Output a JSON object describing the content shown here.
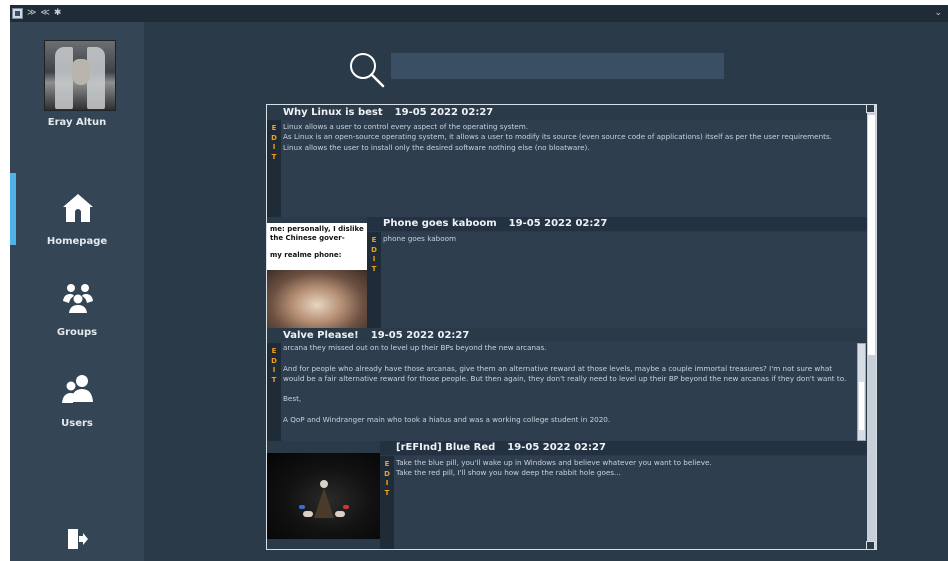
{
  "titlebar": {
    "left_glyphs": [
      "≫",
      "≪",
      "✱"
    ],
    "right_glyph": "⌄"
  },
  "sidebar": {
    "user_name": "Eray Altun",
    "nav": [
      {
        "label": "Homepage",
        "icon": "home-icon",
        "active": true
      },
      {
        "label": "Groups",
        "icon": "groups-icon",
        "active": false
      },
      {
        "label": "Users",
        "icon": "users-icon",
        "active": false
      }
    ],
    "logout_icon": "logout-icon",
    "accent_color": "#4fb3e8"
  },
  "search": {
    "placeholder": "",
    "value": ""
  },
  "edit_letters": [
    "E",
    "D",
    "I",
    "T"
  ],
  "posts": [
    {
      "title": "Why Linux is best",
      "date": "19-05 2022 02:27",
      "lines": [
        "Linux allows a user to control every aspect of the operating system.",
        "As Linux is an open-source operating system, it allows a user to modify its source (even source code of applications) itself as per the user requirements.",
        "Linux allows the user to install only the desired software nothing else (no bloatware)."
      ]
    },
    {
      "title": "Phone goes kaboom",
      "date": "19-05 2022 02:27",
      "meme_top": "me: personally, I dislike the Chinese gover-",
      "meme_bottom": "my realme phone:",
      "lines": [
        "phone goes kaboom"
      ]
    },
    {
      "title": "Valve Please!",
      "date": "19-05 2022 02:27",
      "lines": [
        "arcana they missed out on to level up their BPs beyond the new arcanas.",
        "",
        "And for people who already have those arcanas, give them an alternative reward at those levels, maybe a couple immortal treasures? I'm not sure what would be a fair alternative reward for those people. But then again, they don't really need to level up their BP beyond the new arcanas if they don't want to.",
        "",
        "Best,",
        "",
        "A QoP and Windranger main who took a hiatus and was a working college student in 2020."
      ]
    },
    {
      "title": "[rEFInd] Blue Red",
      "date": "19-05 2022 02:27",
      "lines": [
        "Take the blue pill, you'll wake up in Windows and believe whatever you want to believe.",
        "Take the red pill, I'll show you how deep the rabbit hole goes..."
      ]
    }
  ]
}
